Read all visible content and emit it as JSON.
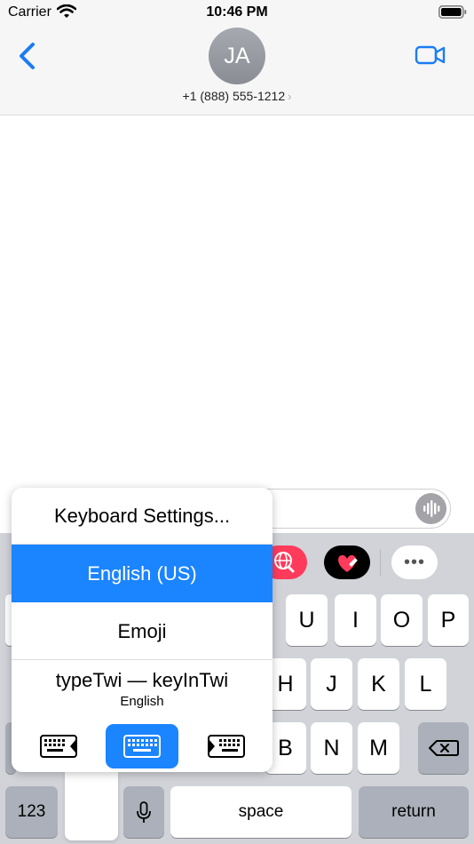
{
  "status_bar": {
    "carrier": "Carrier",
    "time": "10:46 PM",
    "icons": [
      "wifi-icon",
      "battery-icon"
    ]
  },
  "header": {
    "back_icon": "chevron-left-icon",
    "avatar_initials": "JA",
    "phone_number": "+1 (888) 555-1212",
    "detail_chevron": "›",
    "video_icon": "video-camera-icon"
  },
  "message_input": {
    "audio_icon": "waveform-icon"
  },
  "app_strip": {
    "items": [
      "globe-search-app-icon",
      "heart-sticker-app-icon",
      "more-apps-icon"
    ],
    "more_label": "•••"
  },
  "keyboard": {
    "row1": [
      "U",
      "I",
      "O",
      "P"
    ],
    "row2": [
      "H",
      "J",
      "K",
      "L"
    ],
    "row3": [
      "B",
      "N",
      "M"
    ],
    "numbers_label": "123",
    "space_label": "space",
    "return_label": "return",
    "delete_icon": "delete-backward-icon",
    "mic_icon": "microphone-icon"
  },
  "input_switcher": {
    "settings_label": "Keyboard Settings...",
    "selected_label": "English (US)",
    "emoji_label": "Emoji",
    "custom_label": "typeTwi — keyInTwi",
    "custom_sublabel": "English",
    "modes": [
      "keyboard-left-icon",
      "keyboard-full-icon",
      "keyboard-right-icon"
    ],
    "selected_mode": "keyboard-full-icon"
  },
  "colors": {
    "accent": "#1b84ff",
    "keyboard_bg": "#d1d3d9",
    "header_bg": "#f6f6f6",
    "dark_key": "#abb0ba"
  }
}
